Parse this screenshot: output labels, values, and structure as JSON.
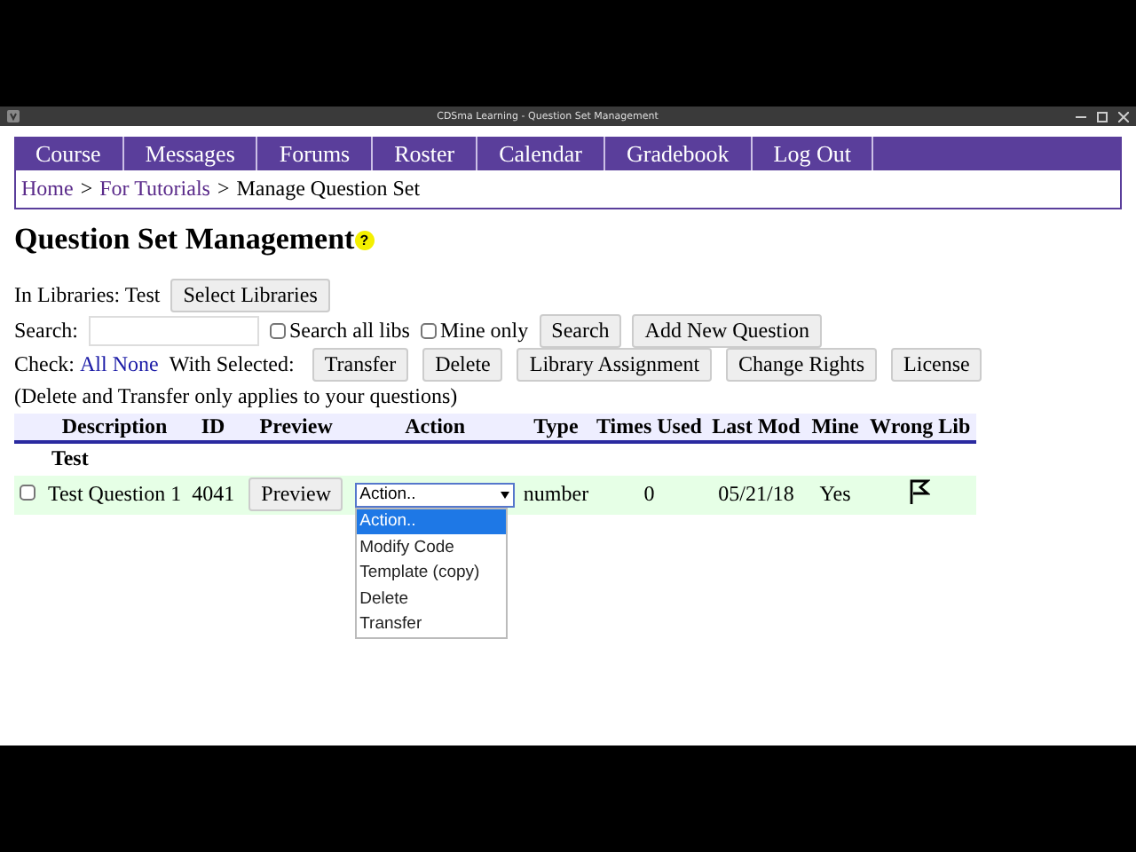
{
  "window": {
    "title": "CDSma Learning - Question Set Management"
  },
  "nav": [
    "Course",
    "Messages",
    "Forums",
    "Roster",
    "Calendar",
    "Gradebook",
    "Log Out"
  ],
  "breadcrumb_separator": ">",
  "breadcrumb": [
    {
      "label": "Home",
      "link": true
    },
    {
      "label": "For Tutorials",
      "link": true
    },
    {
      "label": "Manage Question Set",
      "link": false
    }
  ],
  "heading": "Question Set Management",
  "help_icon": "?",
  "libraries": {
    "label": "In Libraries: Test",
    "button": "Select Libraries"
  },
  "search": {
    "label": "Search:",
    "options": [
      {
        "label": "Search all libs",
        "checked": false
      },
      {
        "label": "Mine only",
        "checked": false
      }
    ],
    "buttons": [
      "Search",
      "Add New Question"
    ]
  },
  "check": {
    "label": "Check:",
    "links": [
      "All",
      "None"
    ],
    "with_selected": "With Selected:",
    "buttons": [
      "Transfer",
      "Delete",
      "Library Assignment",
      "Change Rights",
      "License"
    ]
  },
  "note": "(Delete and Transfer only applies to your questions)",
  "table": {
    "columns": [
      "Description",
      "ID",
      "Preview",
      "Action",
      "Type",
      "Times Used",
      "Last Mod",
      "Mine",
      "Wrong Lib"
    ],
    "group": "Test",
    "rows": [
      {
        "checked": false,
        "description": "Test Question 1",
        "id": "4041",
        "preview": "Preview",
        "action": "Action..",
        "type": "number",
        "times_used": "0",
        "last_mod": "05/21/18",
        "mine": "Yes",
        "wrong_lib": true
      }
    ]
  },
  "action_menu": {
    "open": true,
    "options": [
      {
        "label": "Action..",
        "selected": true
      },
      {
        "label": "Modify Code",
        "selected": false
      },
      {
        "label": "Template (copy)",
        "selected": false
      },
      {
        "label": "Delete",
        "selected": false
      },
      {
        "label": "Transfer",
        "selected": false
      }
    ]
  }
}
